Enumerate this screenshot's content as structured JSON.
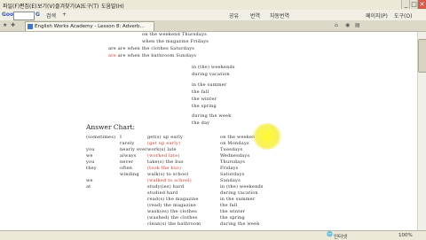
{
  "menubar": {
    "items": [
      "파일(F)",
      "편집(E)",
      "보기(V)",
      "즐겨찾기(A)",
      "도구(T)",
      "도움말(H)"
    ],
    "minimize": "_",
    "maximize": "□",
    "close": "✕"
  },
  "toolbar": {
    "google_label": "Google",
    "search_glyph": "G",
    "items": [
      "검색",
      "+",
      "공유",
      "번역",
      "자동번역"
    ],
    "page_label": "페이지(P)",
    "tools_label": "도구(O)"
  },
  "tab": {
    "title": "English Works Academy - Lesson 8: Adverb..."
  },
  "worksheet": {
    "top_lines": [
      {
        "text": "on the weekend          Thursdays",
        "red": false
      },
      {
        "text": "when the magazine       Fridays",
        "red": false
      },
      {
        "text": "are    are   when the clothes    Saturdays",
        "red": false
      },
      {
        "text": "are    are   when the bathroom   Sundays",
        "red": false
      }
    ],
    "top_red_words": [
      "are"
    ],
    "right_block": [
      "in (the) weekends",
      "during vacation",
      "",
      "in      the summer",
      "          the fall",
      "          the winter",
      "          the spring",
      "",
      "during       the week",
      "                 the day"
    ],
    "answer_heading": "Answer Chart:",
    "answer_cols": {
      "c1": [
        "(sometimes)",
        "",
        "   you",
        "   we",
        "   you",
        "   they",
        "",
        "   we",
        "   at"
      ],
      "c2": [
        "I",
        "rarely",
        "nearly ever",
        "always",
        "never",
        "often",
        "winding"
      ],
      "c3": [
        "get(s) up early",
        "(get up early)",
        "work(s) late",
        "(worked late)",
        "take(s) the bus",
        "(took the bus)",
        "walk(s) to school",
        "(walked to school)",
        "study(ies) hard",
        "studied hard",
        "read(s) the magazine",
        "(read) the magazine",
        "wash(es) the clothes",
        "(washed) the clothes",
        "clean(s) the bathroom"
      ],
      "c4": [
        "on the weekend",
        "on   Mondays",
        "      Tuesdays",
        "      Wednesdays",
        "      Thursdays",
        "      Fridays",
        "      Saturdays",
        "      Sundays",
        "in (the) weekends",
        "during vacation",
        "in     the summer",
        "        the fall",
        "        the winter",
        "        the spring",
        "during the week"
      ]
    }
  },
  "statusbar": {
    "zone": "인터넷",
    "zoom": "100%"
  }
}
